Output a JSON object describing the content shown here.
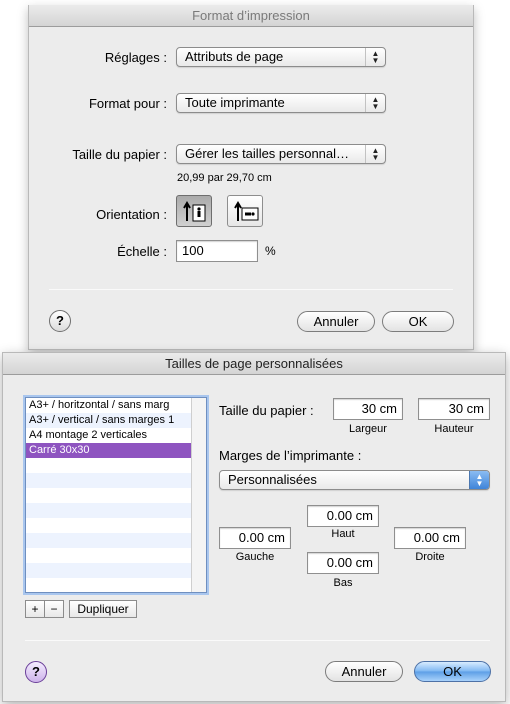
{
  "page_setup": {
    "title": "Format d’impression",
    "settings_label": "Réglages :",
    "settings_value": "Attributs de page",
    "format_for_label": "Format pour :",
    "format_for_value": "Toute imprimante",
    "paper_size_label": "Taille du papier :",
    "paper_size_value": "Gérer les tailles personnal…",
    "paper_size_dims": "20,99 par 29,70 cm",
    "orientation_label": "Orientation :",
    "orientation_options": [
      "portrait",
      "landscape"
    ],
    "orientation_selected": "portrait",
    "scale_label": "Échelle :",
    "scale_value": "100",
    "scale_unit": "%",
    "help_label": "?",
    "cancel_label": "Annuler",
    "ok_label": "OK"
  },
  "custom_sizes": {
    "title": "Tailles de page personnalisées",
    "list": [
      {
        "label": "A3+ / horitzontal / sans marg",
        "selected": false
      },
      {
        "label": "A3+ / vertical / sans marges 1",
        "selected": false
      },
      {
        "label": "A4 montage 2 verticales",
        "selected": false
      },
      {
        "label": "Carré 30x30",
        "selected": true
      }
    ],
    "add_label": "+",
    "remove_label": "−",
    "duplicate_label": "Dupliquer",
    "paper_size_label": "Taille du papier :",
    "width_value": "30 cm",
    "height_value": "30 cm",
    "width_caption": "Largeur",
    "height_caption": "Hauteur",
    "margins_label": "Marges de l’imprimante :",
    "margins_value": "Personnalisées",
    "margin_top": "0.00 cm",
    "margin_left": "0.00 cm",
    "margin_right": "0.00 cm",
    "margin_bottom": "0.00 cm",
    "top_caption": "Haut",
    "left_caption": "Gauche",
    "right_caption": "Droite",
    "bottom_caption": "Bas",
    "help_label": "?",
    "cancel_label": "Annuler",
    "ok_label": "OK",
    "accent_selection": "#8e54c0",
    "accent_default_button": "#5c9ee6"
  }
}
